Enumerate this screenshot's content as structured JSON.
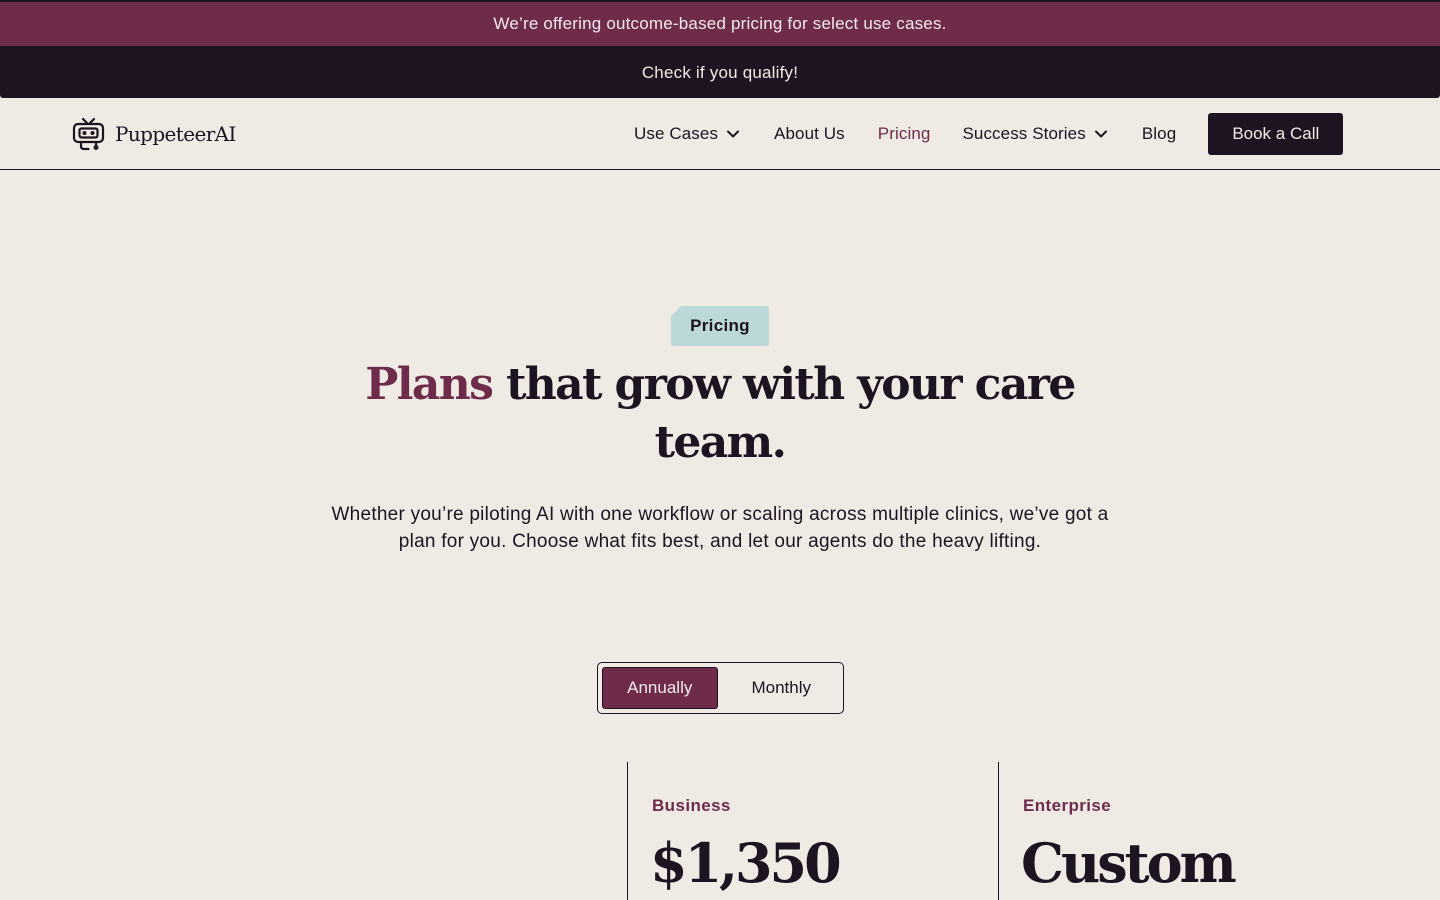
{
  "colors": {
    "brand": "#6f2c4a",
    "dark": "#1e1321",
    "background": "#efebe4",
    "tag": "#bcd9d9"
  },
  "promo": {
    "text": "We’re offering outcome-based pricing for select use cases.",
    "cta": "Check if you qualify!"
  },
  "nav": {
    "logo_icon": "robot-puppet-icon",
    "logo_text": "PuppeteerAI",
    "items": [
      {
        "label": "Use Cases",
        "dropdown": true
      },
      {
        "label": "About Us"
      },
      {
        "label": "Pricing",
        "active": true
      },
      {
        "label": "Success Stories",
        "dropdown": true
      },
      {
        "label": "Blog"
      }
    ],
    "cta": "Book a Call"
  },
  "hero": {
    "tag": "Pricing",
    "title_accent": "Plans",
    "title_rest": "that grow with your care team.",
    "subtitle": "Whether you’re piloting AI with one workflow or scaling across multiple clinics, we’ve got a plan for you. Choose what fits best, and let our agents do the heavy lifting."
  },
  "billing": {
    "options": [
      "Annually",
      "Monthly"
    ],
    "selected": "Annually"
  },
  "plans": [
    {
      "name": "Business",
      "price": "$1,350"
    },
    {
      "name": "Enterprise",
      "price": "Custom"
    }
  ]
}
